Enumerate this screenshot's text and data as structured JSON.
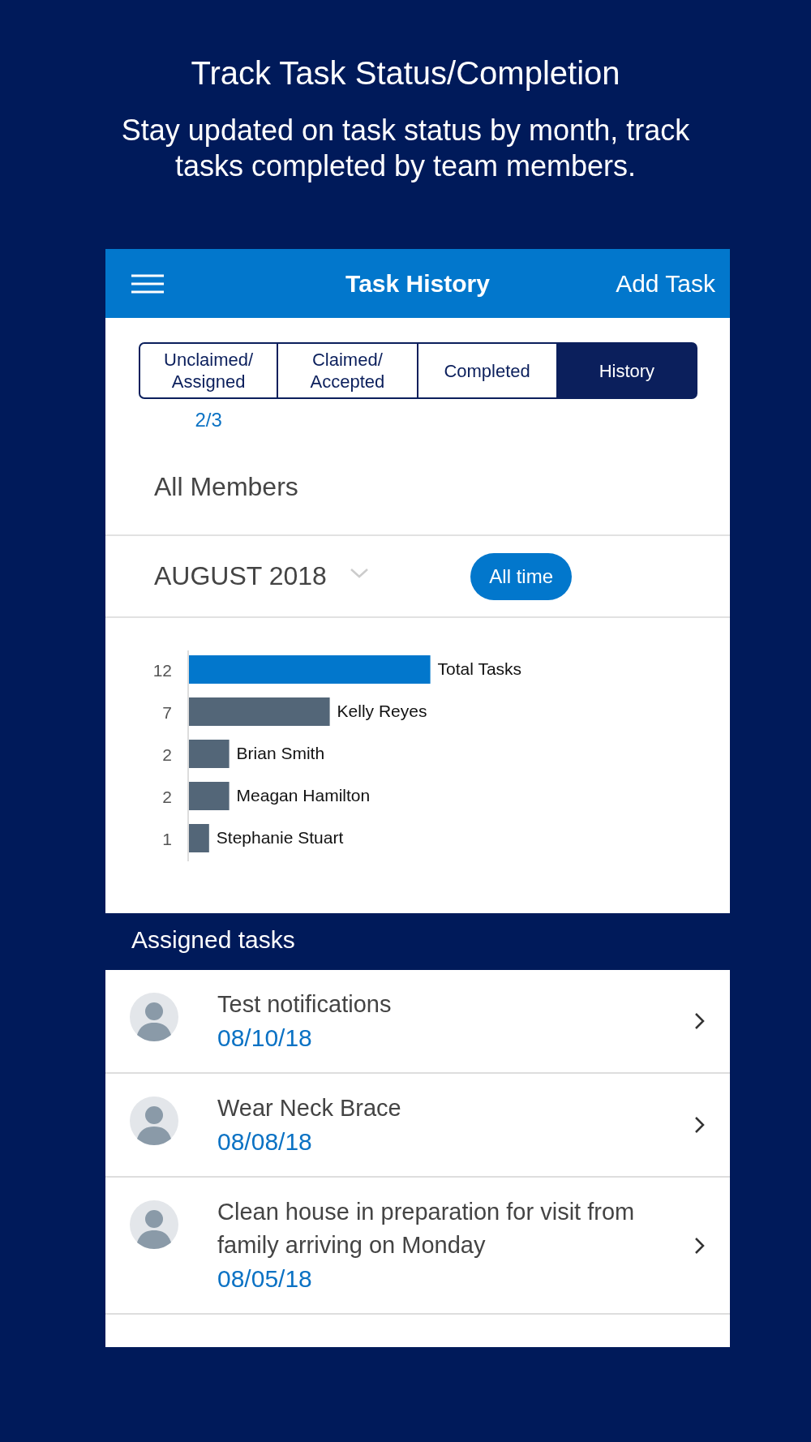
{
  "headline": "Track Task Status/Completion",
  "subtitle": "Stay updated on task status by month, track tasks completed by team members.",
  "app": {
    "title": "Task History",
    "action": "Add Task",
    "tabs": [
      {
        "label": "Unclaimed/ Assigned",
        "selected": false,
        "badge": "2/3"
      },
      {
        "label": "Claimed/ Accepted",
        "selected": false
      },
      {
        "label": "Completed",
        "selected": false
      },
      {
        "label": "History",
        "selected": true
      }
    ],
    "member_filter": "All Members",
    "month": "AUGUST 2018",
    "range_button": "All time",
    "chart_data": {
      "type": "bar",
      "orientation": "horizontal",
      "categories": [
        "Total Tasks",
        "Kelly Reyes",
        "Brian Smith",
        "Meagan Hamilton",
        "Stephanie Stuart"
      ],
      "values": [
        12,
        7,
        2,
        2,
        1
      ],
      "data_labels": true
    },
    "section_title": "Assigned tasks",
    "tasks": [
      {
        "title": "Test notifications",
        "date": "08/10/18"
      },
      {
        "title": "Wear Neck Brace",
        "date": "08/08/18"
      },
      {
        "title": "Clean house in preparation for visit from family arriving on Monday",
        "date": "08/05/18"
      }
    ]
  }
}
